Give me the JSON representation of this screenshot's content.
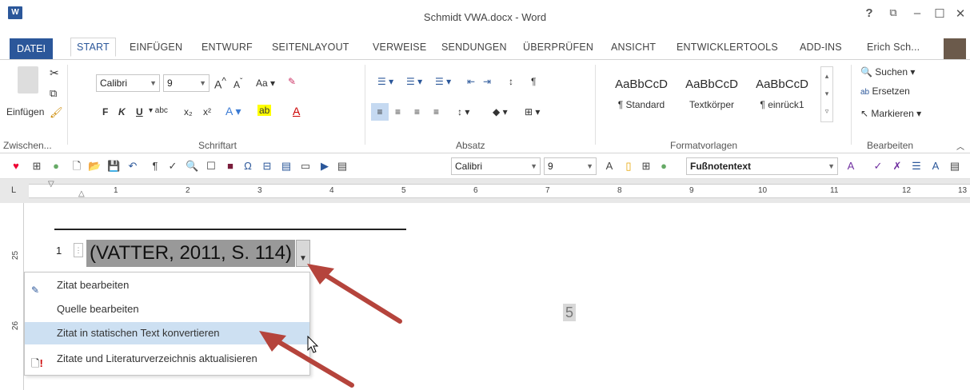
{
  "window": {
    "title": "Schmidt VWA.docx - Word",
    "help": "?",
    "restore_ribbon": "⧉",
    "minimize": "–",
    "maximize": "☐",
    "close": "✕",
    "app_icon": "W"
  },
  "tabs": {
    "file": "DATEI",
    "items": [
      "START",
      "EINFÜGEN",
      "ENTWURF",
      "SEITENLAYOUT",
      "VERWEISE",
      "SENDUNGEN",
      "ÜBERPRÜFEN",
      "ANSICHT",
      "ENTWICKLERTOOLS",
      "ADD-INS"
    ],
    "active": "START",
    "user": "Erich Sch..."
  },
  "clipboard": {
    "paste_label": "Einfügen",
    "group_label": "Zwischen..."
  },
  "font": {
    "name": "Calibri",
    "size": "9",
    "bold": "F",
    "italic": "K",
    "underline": "U",
    "group_label": "Schriftart"
  },
  "paragraph": {
    "group_label": "Absatz"
  },
  "styles": {
    "items": [
      {
        "preview": "AaBbCcD",
        "name": "¶ Standard"
      },
      {
        "preview": "AaBbCcD",
        "name": "Textkörper"
      },
      {
        "preview": "AaBbCcD",
        "name": "¶ einrück1"
      }
    ],
    "group_label": "Formatvorlagen"
  },
  "editing": {
    "search": "Suchen",
    "replace": "Ersetzen",
    "select": "Markieren",
    "group_label": "Bearbeiten"
  },
  "qat": {
    "font": "Calibri",
    "size": "9",
    "style": "Fußnotentext"
  },
  "ruler": {
    "numbers": [
      "1",
      "2",
      "3",
      "4",
      "5",
      "6",
      "7",
      "8",
      "9",
      "10",
      "11",
      "12",
      "13"
    ],
    "vnumbers": [
      "25",
      "26"
    ]
  },
  "document": {
    "footnote_number": "1",
    "citation": "(VATTER, 2011, S. 114)",
    "page_number": "5"
  },
  "context_menu": {
    "items": [
      {
        "label": "Zitat bearbeiten",
        "icon": "edit-citation-icon"
      },
      {
        "label": "Quelle bearbeiten",
        "icon": ""
      },
      {
        "label": "Zitat in statischen Text konvertieren",
        "icon": "",
        "highlighted": true
      },
      {
        "label": "Zitate und Literaturverzeichnis aktualisieren",
        "icon": "update-bibliography-icon"
      }
    ]
  },
  "colors": {
    "accent": "#2b579a",
    "highlight": "#cde0f2",
    "arrow": "#b5443c"
  }
}
